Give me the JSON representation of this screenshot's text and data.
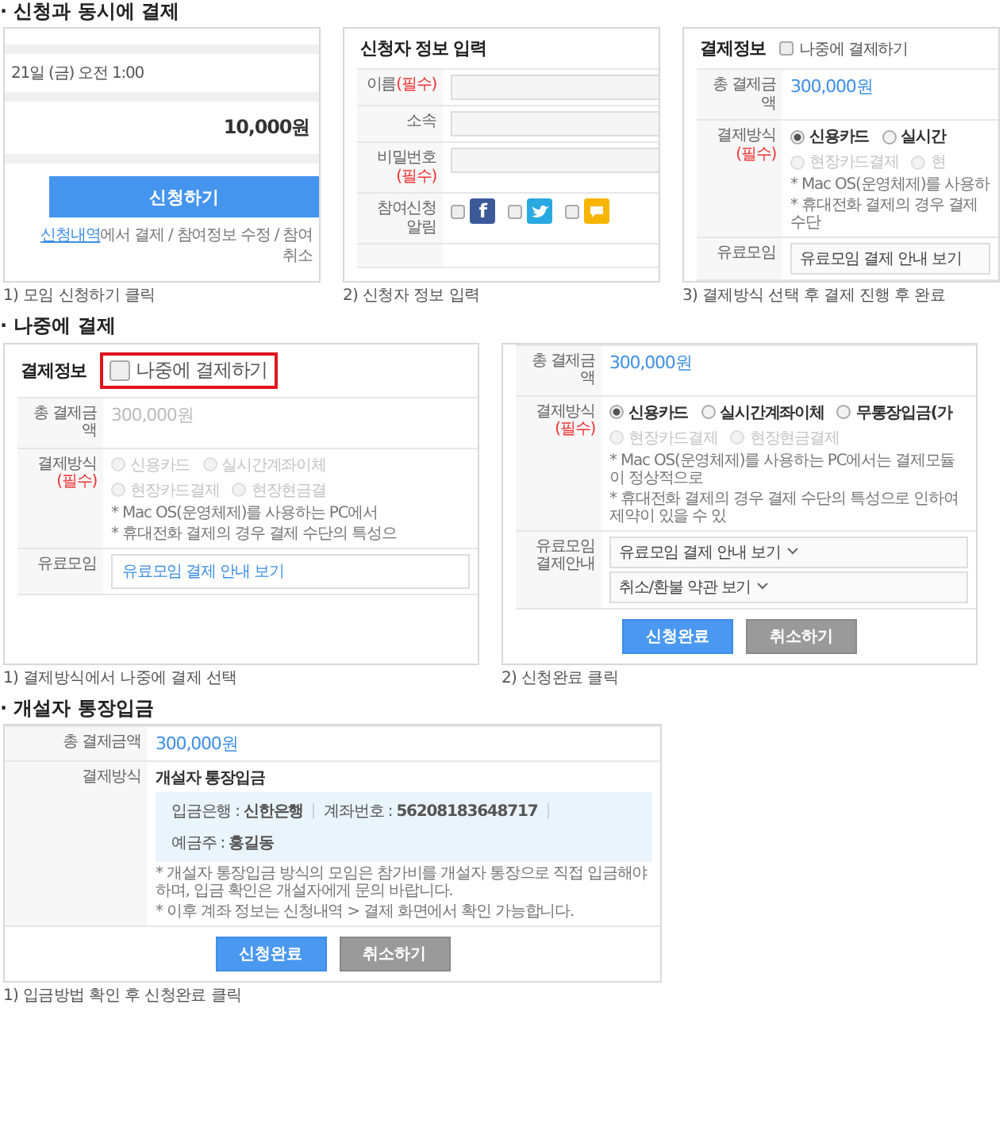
{
  "sections": [
    {
      "title": "· 신청과 동시에 결제",
      "steps": [
        {
          "caption": "1) 모임 신청하기 클릭",
          "screen": {
            "kind": "apply",
            "date": "21일 (금) 오전 1:00",
            "price": "10,000원",
            "button": "신청하기",
            "link": "신청내역",
            "note": "에서 결제 / 참여정보 수정 / 참여 취소"
          }
        },
        {
          "caption": "2) 신청자 정보 입력",
          "screen": {
            "kind": "form",
            "title": "신청자 정보 입력",
            "rows": [
              {
                "kind": "input",
                "label": "이름",
                "required": "(필수)"
              },
              {
                "kind": "input",
                "label": "소속"
              },
              {
                "kind": "input",
                "label": "비밀번호",
                "required": "(필수)"
              },
              {
                "kind": "social",
                "label": "참여신청알림",
                "options": [
                  {
                    "glyph": "f",
                    "color": "#3b5998",
                    "checked": false
                  },
                  {
                    "color": "#29a9e1",
                    "checked": false
                  },
                  {
                    "color": "#f7b500",
                    "checked": false
                  }
                ]
              },
              {
                "kind": "blank"
              }
            ]
          }
        },
        {
          "caption": "3) 결제방식 선택 후 결제 진행 후 완료",
          "screen": {
            "kind": "form",
            "title": "결제정보",
            "later": {
              "label": "나중에 결제하기",
              "checked": false,
              "highlighted": false
            },
            "rows": [
              {
                "kind": "amount",
                "label": "총 결제금액",
                "value": "300,000원",
                "disabled": false
              },
              {
                "kind": "methods",
                "label": "결제방식",
                "required": "(필수)",
                "lines": [
                  [
                    {
                      "label": "신용카드",
                      "selected": true,
                      "disabled": false
                    },
                    {
                      "label": "실시간",
                      "selected": false,
                      "disabled": false
                    }
                  ],
                  [
                    {
                      "label": "현장카드결제",
                      "selected": false,
                      "disabled": true
                    },
                    {
                      "label": "현",
                      "selected": false,
                      "disabled": true
                    }
                  ]
                ],
                "notes": [
                  "* Mac OS(운영체제)를 사용하",
                  "* 휴대전화 결제의 경우 결제 수단"
                ]
              },
              {
                "kind": "guide",
                "label": "유료모임",
                "items": [
                  {
                    "kind": "box",
                    "text": "유료모임 결제 안내 보기"
                  }
                ]
              }
            ]
          }
        }
      ]
    },
    {
      "title": "· 나중에 결제",
      "steps": [
        {
          "caption": "1) 결제방식에서 나중에 결제 선택",
          "screen": {
            "kind": "form",
            "title": "결제정보",
            "later": {
              "label": "나중에 결제하기",
              "checked": false,
              "highlighted": true
            },
            "rows": [
              {
                "kind": "amount",
                "label": "총 결제금액",
                "value": "300,000원",
                "disabled": true
              },
              {
                "kind": "methods",
                "label": "결제방식",
                "required": "(필수)",
                "lines": [
                  [
                    {
                      "label": "신용카드",
                      "selected": false,
                      "disabled": true
                    },
                    {
                      "label": "실시간계좌이체",
                      "selected": false,
                      "disabled": true
                    }
                  ],
                  [
                    {
                      "label": "현장카드결제",
                      "selected": false,
                      "disabled": true
                    },
                    {
                      "label": "현장현금결",
                      "selected": false,
                      "disabled": true
                    }
                  ]
                ],
                "notes": [
                  "* Mac OS(운영체제)를 사용하는 PC에서",
                  "* 휴대전화 결제의 경우 결제 수단의 특성으"
                ]
              },
              {
                "kind": "guide",
                "label": "유료모임",
                "items": [
                  {
                    "kind": "link",
                    "text": "유료모임 결제 안내 보기"
                  }
                ]
              }
            ]
          }
        },
        {
          "caption": "2) 신청완료 클릭",
          "screen": {
            "kind": "form",
            "rows": [
              {
                "kind": "amount",
                "label": "총 결제금액",
                "value": "300,000원",
                "disabled": false
              },
              {
                "kind": "methods",
                "label": "결제방식",
                "required": "(필수)",
                "lines": [
                  [
                    {
                      "label": "신용카드",
                      "selected": true,
                      "disabled": false
                    },
                    {
                      "label": "실시간계좌이체",
                      "selected": false,
                      "disabled": false
                    },
                    {
                      "label": "무통장입금(가",
                      "selected": false,
                      "disabled": false
                    }
                  ],
                  [
                    {
                      "label": "현장카드결제",
                      "selected": false,
                      "disabled": true
                    },
                    {
                      "label": "현장현금결제",
                      "selected": false,
                      "disabled": true
                    }
                  ]
                ],
                "notes": [
                  "* Mac OS(운영체제)를 사용하는 PC에서는 결제모듈이 정상적으로",
                  "* 휴대전화 결제의 경우 결제 수단의 특성으로 인하여 제약이 있을 수 있"
                ]
              },
              {
                "kind": "guide",
                "label": "유료모임 결제안내",
                "items": [
                  {
                    "kind": "dropdown",
                    "text": "유료모임 결제 안내 보기"
                  },
                  {
                    "kind": "dropdown",
                    "text": "취소/환불 약관 보기"
                  }
                ]
              }
            ],
            "buttons": [
              {
                "kind": "primary",
                "label": "신청완료"
              },
              {
                "kind": "secondary",
                "label": "취소하기"
              }
            ]
          }
        }
      ]
    },
    {
      "title": "· 개설자 통장입금",
      "steps": [
        {
          "caption": "1) 입금방법 확인 후 신청완료 클릭",
          "screen": {
            "kind": "form",
            "rows": [
              {
                "kind": "amount",
                "label": "총 결제금액",
                "value": "300,000원",
                "disabled": false
              },
              {
                "kind": "bank",
                "label": "결제방식",
                "title": "개설자 통장입금",
                "info": [
                  {
                    "label": "입금은행 :",
                    "value": "신한은행"
                  },
                  {
                    "label": "계좌번호 :",
                    "value": "56208183648717"
                  },
                  {
                    "label": "예금주 :",
                    "value": "홍길동"
                  }
                ],
                "notes": [
                  "* 개설자 통장입금 방식의 모임은 참가비를 개설자 통장으로 직접 입금해야 하며, 입금 확인은 개설자에게 문의 바랍니다.",
                  "* 이후 계좌 정보는 신청내역 > 결제 화면에서 확인 가능합니다."
                ]
              }
            ],
            "buttons": [
              {
                "kind": "primary",
                "label": "신청완료"
              },
              {
                "kind": "secondary",
                "label": "취소하기"
              }
            ]
          }
        }
      ]
    }
  ]
}
